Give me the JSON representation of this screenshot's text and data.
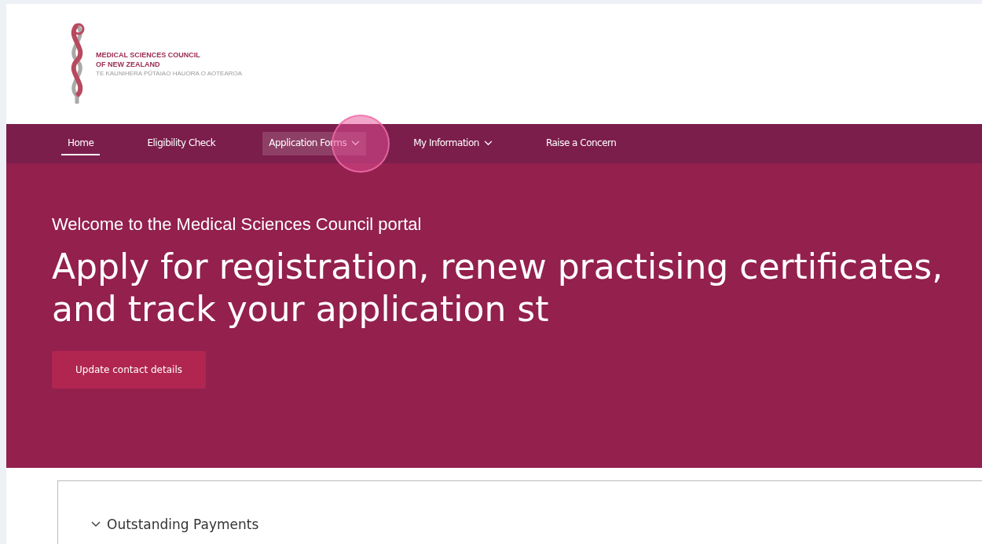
{
  "header": {
    "logo": {
      "name_line_1": "MEDICAL SCIENCES COUNCIL",
      "name_line_2": "OF NEW ZEALAND",
      "tagline": "TE KAUNIHERA PŪTAIAO HAUORA O AOTEAROA"
    }
  },
  "nav": {
    "items": [
      {
        "label": "Home",
        "selected": true,
        "highlighted": false,
        "has_menu": false
      },
      {
        "label": "Eligibility Check",
        "selected": false,
        "highlighted": false,
        "has_menu": false
      },
      {
        "label": "Application Forms",
        "selected": false,
        "highlighted": true,
        "has_menu": true
      },
      {
        "label": "My Information",
        "selected": false,
        "highlighted": false,
        "has_menu": true
      },
      {
        "label": "Raise a Concern",
        "selected": false,
        "highlighted": false,
        "has_menu": false
      }
    ]
  },
  "hero": {
    "subtitle": "Welcome to the Medical Sciences Council portal",
    "title": "Apply for registration, renew practising certificates, and track your application st",
    "button": "Update contact details"
  },
  "sections": [
    {
      "title": "Outstanding Payments",
      "expanded": true
    }
  ]
}
